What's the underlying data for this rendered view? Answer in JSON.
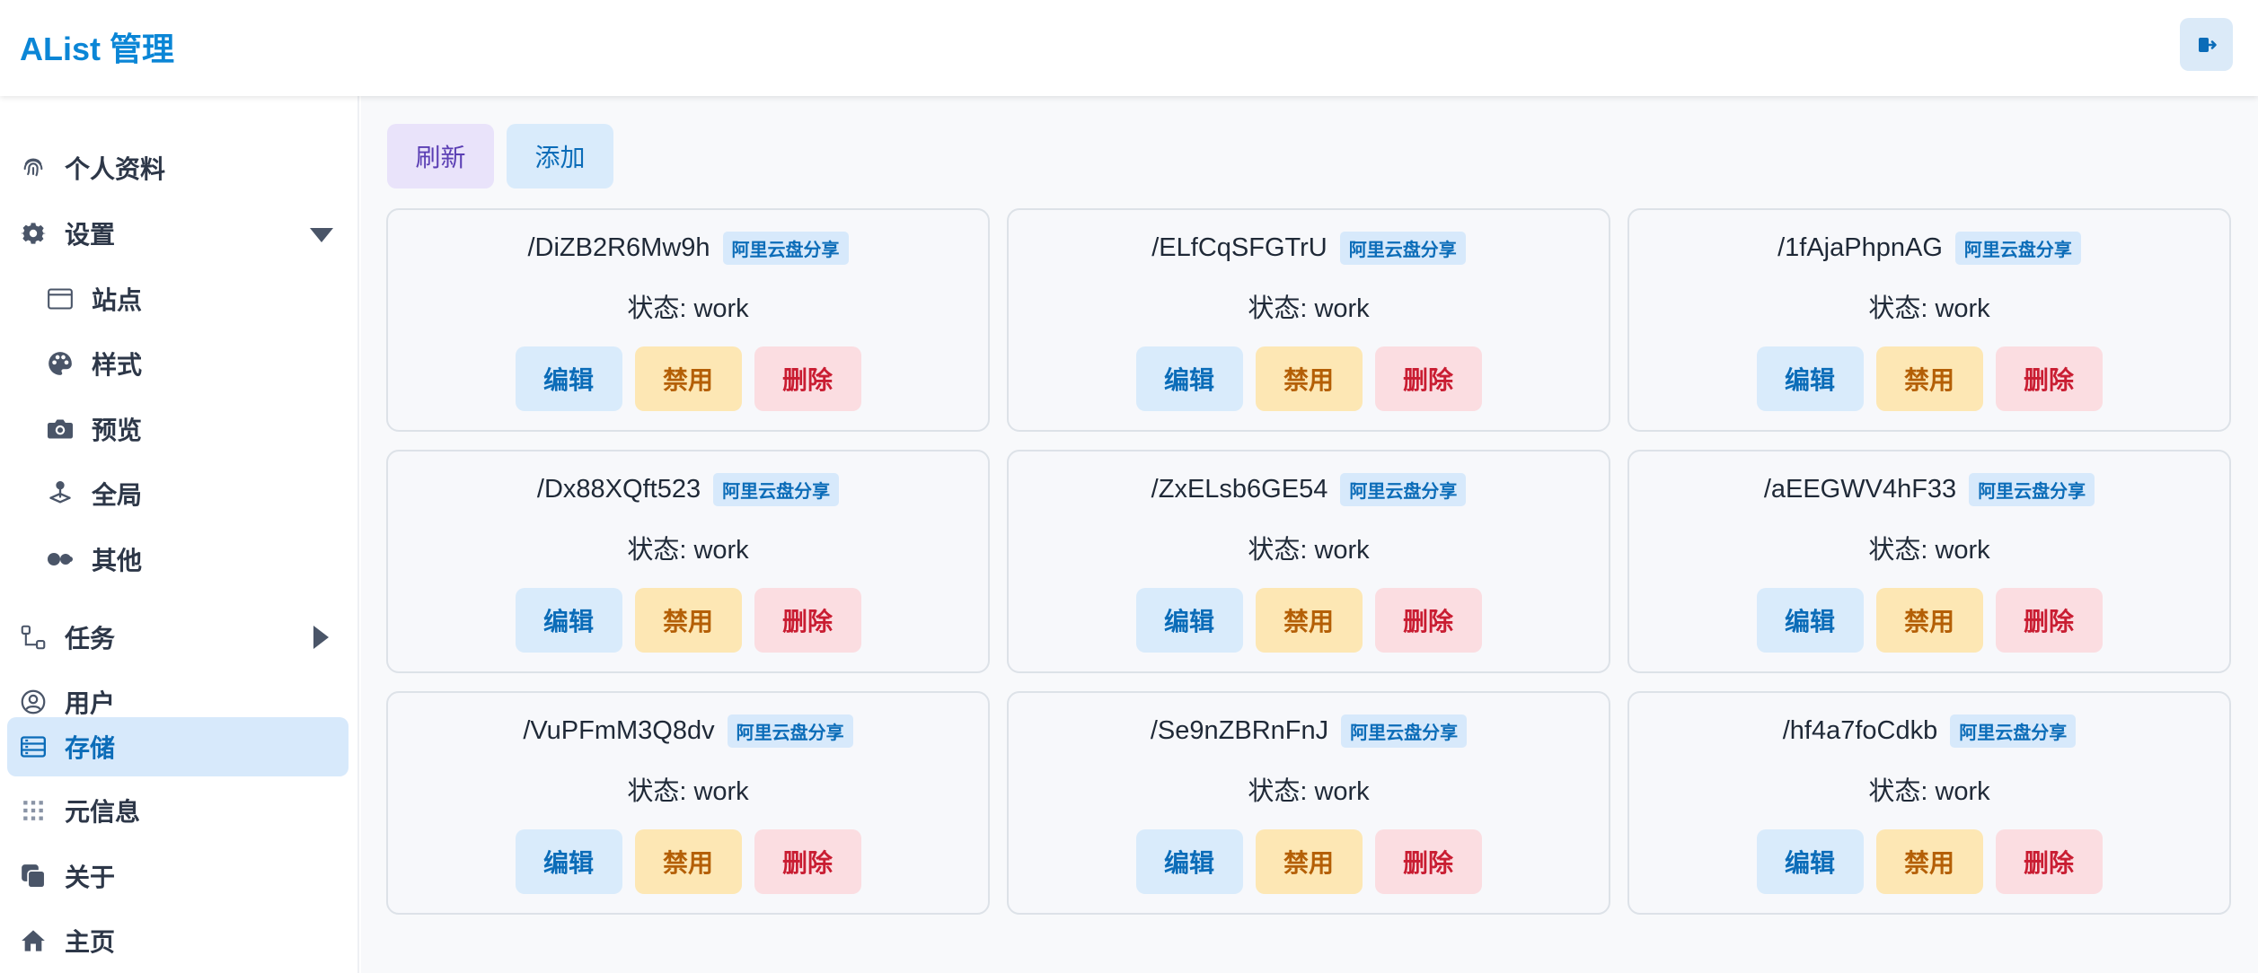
{
  "app": {
    "title": "AList 管理"
  },
  "header": {
    "logout_icon": "logout-icon"
  },
  "sidebar": {
    "items": [
      {
        "label": "个人资料",
        "icon": "fingerprint-icon"
      },
      {
        "label": "设置",
        "icon": "gear-icon",
        "caret": "expanded"
      },
      {
        "label": "站点",
        "icon": "window-icon"
      },
      {
        "label": "样式",
        "icon": "palette-icon"
      },
      {
        "label": "预览",
        "icon": "camera-icon"
      },
      {
        "label": "全局",
        "icon": "joystick-icon"
      },
      {
        "label": "其他",
        "icon": "toggle-icon"
      },
      {
        "label": "任务",
        "icon": "workflow-icon",
        "caret": "collapsed"
      },
      {
        "label": "用户",
        "icon": "user-circle-icon"
      },
      {
        "label": "存储",
        "icon": "storage-icon",
        "active": true
      },
      {
        "label": "元信息",
        "icon": "grid-dots-icon"
      },
      {
        "label": "关于",
        "icon": "copy-icon"
      },
      {
        "label": "主页",
        "icon": "home-icon"
      }
    ]
  },
  "toolbar": {
    "refresh_label": "刷新",
    "add_label": "添加"
  },
  "storages": [
    {
      "mount_path": "/DiZB2R6Mw9h",
      "driver": "阿里云盘分享",
      "status": "状态: work"
    },
    {
      "mount_path": "/ELfCqSFGTrU",
      "driver": "阿里云盘分享",
      "status": "状态: work"
    },
    {
      "mount_path": "/1fAjaPhpnAG",
      "driver": "阿里云盘分享",
      "status": "状态: work"
    },
    {
      "mount_path": "/Dx88XQft523",
      "driver": "阿里云盘分享",
      "status": "状态: work"
    },
    {
      "mount_path": "/ZxELsb6GE54",
      "driver": "阿里云盘分享",
      "status": "状态: work"
    },
    {
      "mount_path": "/aEEGWV4hF33",
      "driver": "阿里云盘分享",
      "status": "状态: work"
    },
    {
      "mount_path": "/VuPFmM3Q8dv",
      "driver": "阿里云盘分享",
      "status": "状态: work"
    },
    {
      "mount_path": "/Se9nZBRnFnJ",
      "driver": "阿里云盘分享",
      "status": "状态: work"
    },
    {
      "mount_path": "/hf4a7foCdkb",
      "driver": "阿里云盘分享",
      "status": "状态: work"
    }
  ],
  "actions": {
    "edit": "编辑",
    "disable": "禁用",
    "delete": "删除"
  },
  "colors": {
    "brand": "#0b86d6",
    "active_bg": "#d7e9fb",
    "edit": "#0b6cb8",
    "disable": "#b45f06",
    "delete": "#c91d32"
  }
}
